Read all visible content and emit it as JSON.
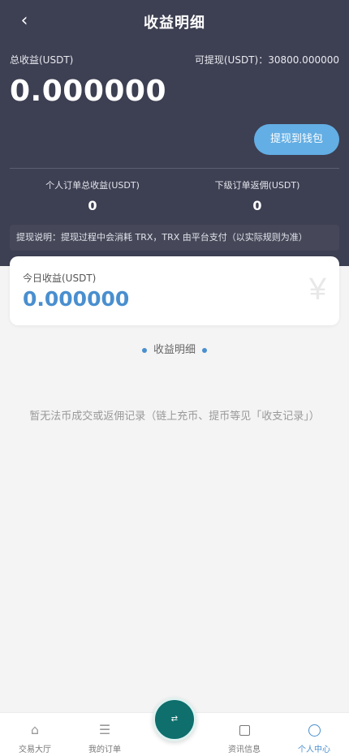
{
  "header": {
    "back_icon": "chevron-left-icon",
    "title": "收益明细"
  },
  "summary": {
    "total_label": "总收益(USDT)",
    "available_label": "可提现(USDT)：30800.000000",
    "total_value": "0.000000",
    "withdraw_button": "提现到钱包",
    "personal_label": "个人订单总收益(USDT)",
    "personal_value": "0",
    "sub_label": "下级订单返佣(USDT)",
    "sub_value": "0",
    "notice": "提现说明：提现过程中会消耗 TRX，TRX 由平台支付（以实际规则为准）"
  },
  "today": {
    "label": "今日收益(USDT)",
    "value": "0.000000",
    "icon": "yen-icon",
    "symbol": "¥"
  },
  "section_title": "收益明细",
  "empty_text": "暂无法币成交或返佣记录（链上充币、提币等见「收支记录」）",
  "tabbar": {
    "items": [
      {
        "label": "交易大厅",
        "icon": "home-icon",
        "glyph": "⌂"
      },
      {
        "label": "我的订单",
        "icon": "list-icon",
        "glyph": "☰"
      },
      {
        "label": "资讯信息",
        "icon": "square-icon",
        "glyph": ""
      },
      {
        "label": "个人中心",
        "icon": "circle-user-icon",
        "glyph": ""
      }
    ],
    "active_label": "个人中心",
    "center_icon": "exchange-icon",
    "center_glyph": "⇄"
  },
  "colors": {
    "header_bg": "#3d3f52",
    "accent": "#4a8fcf",
    "button": "#63aee4",
    "center_button": "#0e6f6d"
  }
}
